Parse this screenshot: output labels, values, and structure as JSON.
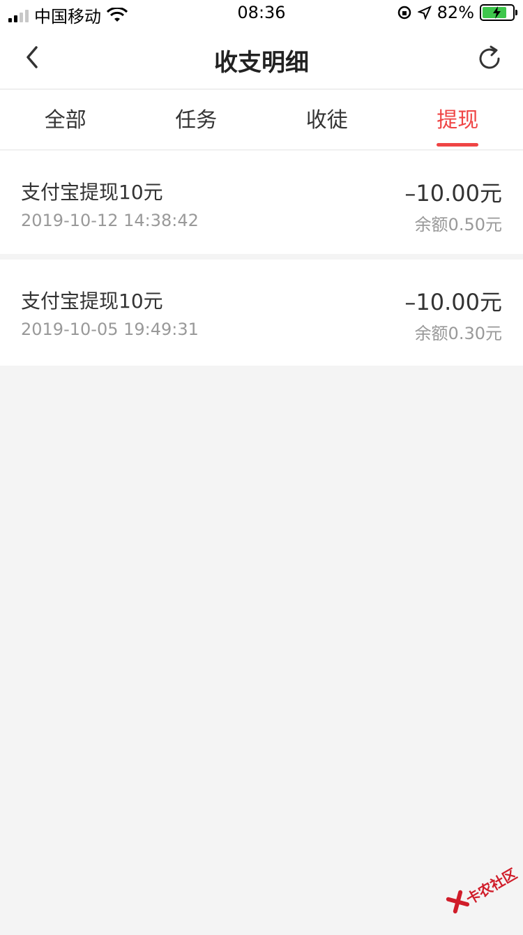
{
  "status_bar": {
    "carrier": "中国移动",
    "time": "08:36",
    "battery_percent": "82%",
    "battery_level": 0.82,
    "signal_bars": 2
  },
  "nav": {
    "title": "收支明细",
    "back_icon": "chevron-left-icon",
    "refresh_icon": "refresh-icon"
  },
  "tabs": [
    {
      "label": "全部",
      "active": false
    },
    {
      "label": "任务",
      "active": false
    },
    {
      "label": "收徒",
      "active": false
    },
    {
      "label": "提现",
      "active": true
    }
  ],
  "records": [
    {
      "title": "支付宝提现10元",
      "time": "2019-10-12 14:38:42",
      "amount": "–10.00元",
      "balance": "余额0.50元"
    },
    {
      "title": "支付宝提现10元",
      "time": "2019-10-05 19:49:31",
      "amount": "–10.00元",
      "balance": "余额0.30元"
    }
  ],
  "watermark": {
    "text": "卡农社区"
  },
  "colors": {
    "accent": "#ef4444",
    "background": "#f4f4f4",
    "battery": "#3ec74c"
  }
}
